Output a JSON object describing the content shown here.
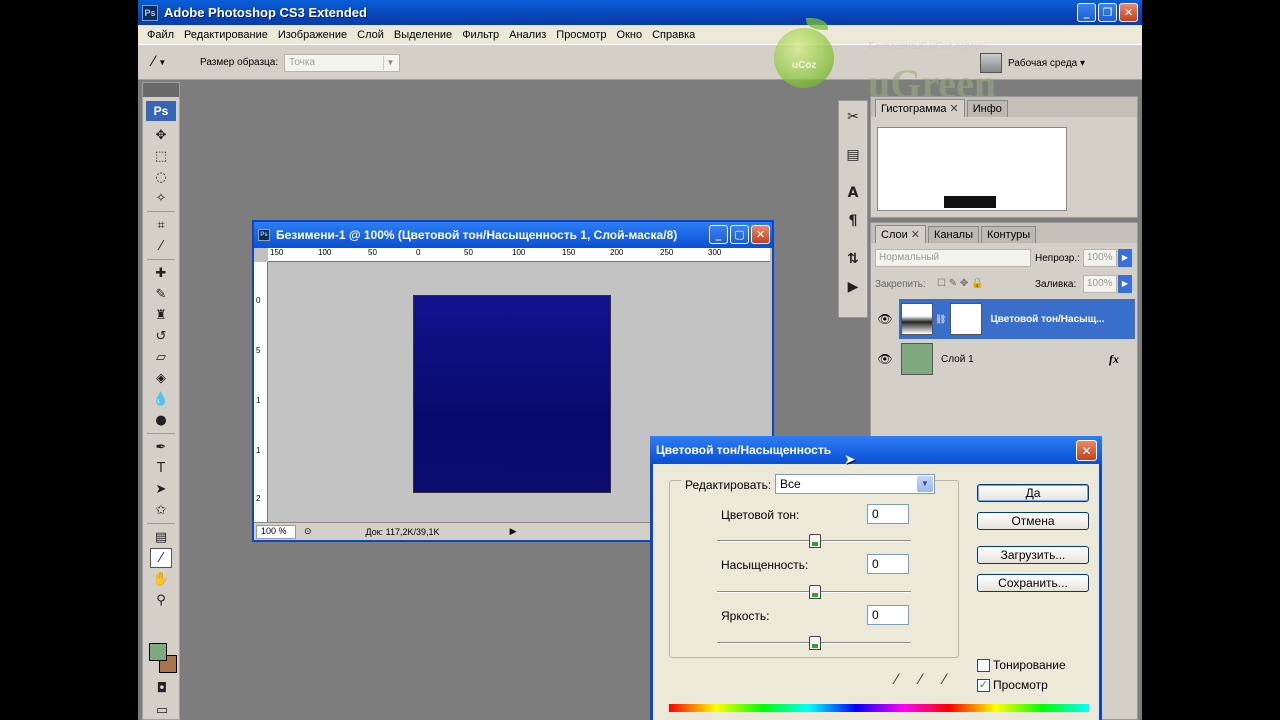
{
  "app": {
    "title": "Adobe Photoshop CS3 Extended",
    "logo": "Ps"
  },
  "menu": [
    "Файл",
    "Редактирование",
    "Изображение",
    "Слой",
    "Выделение",
    "Фильтр",
    "Анализ",
    "Просмотр",
    "Окно",
    "Справка"
  ],
  "options": {
    "sample_label": "Размер образца:",
    "sample_value": "Точка",
    "workspace_label": "Рабочая среда ▾"
  },
  "watermark": {
    "brand": "uGreen",
    "tagline": "Бесплатный uCoz сервис",
    "apple_text": "uCoz"
  },
  "tools": {
    "ps_label": "Ps"
  },
  "document": {
    "title": "Безимени-1 @ 100% (Цветовой тон/Насыщенность 1, Слой-маска/8)",
    "zoom": "100 %",
    "doc_info": "Док: 117,2K/39,1K",
    "ruler_h": [
      "150",
      "100",
      "50",
      "0",
      "50",
      "100",
      "150",
      "200",
      "250",
      "300"
    ],
    "ruler_v": [
      "0",
      "5",
      "1",
      "1",
      "2"
    ]
  },
  "histogram_panel": {
    "tabs": [
      "Гистограмма",
      "Инфо"
    ]
  },
  "layers_panel": {
    "tabs": [
      "Слои",
      "Каналы",
      "Контуры"
    ],
    "blend_mode": "Нормальный",
    "opacity_label": "Непрозр.:",
    "opacity_value": "100%",
    "lock_label": "Закрепить:",
    "fill_label": "Заливка:",
    "fill_value": "100%",
    "layers": [
      {
        "name": "Цветовой тон/Насыщ...",
        "selected": true
      },
      {
        "name": "Слой 1",
        "selected": false,
        "fx": "fx"
      }
    ]
  },
  "dialog": {
    "title": "Цветовой тон/Насыщенность",
    "edit_label": "Редактировать:",
    "edit_value": "Все",
    "hue_label": "Цветовой тон:",
    "hue_value": "0",
    "saturation_label": "Насыщенность:",
    "saturation_value": "0",
    "lightness_label": "Яркость:",
    "lightness_value": "0",
    "ok_label": "Да",
    "cancel_label": "Отмена",
    "load_label": "Загрузить...",
    "save_label": "Сохранить...",
    "colorize_label": "Тонирование",
    "colorize_checked": false,
    "preview_label": "Просмотр",
    "preview_checked": true
  },
  "colors": {
    "foreground": "#7faa7f",
    "background": "#a9764c",
    "image_fill": "#0a0a7a",
    "title_blue": "#0a4fd4"
  }
}
